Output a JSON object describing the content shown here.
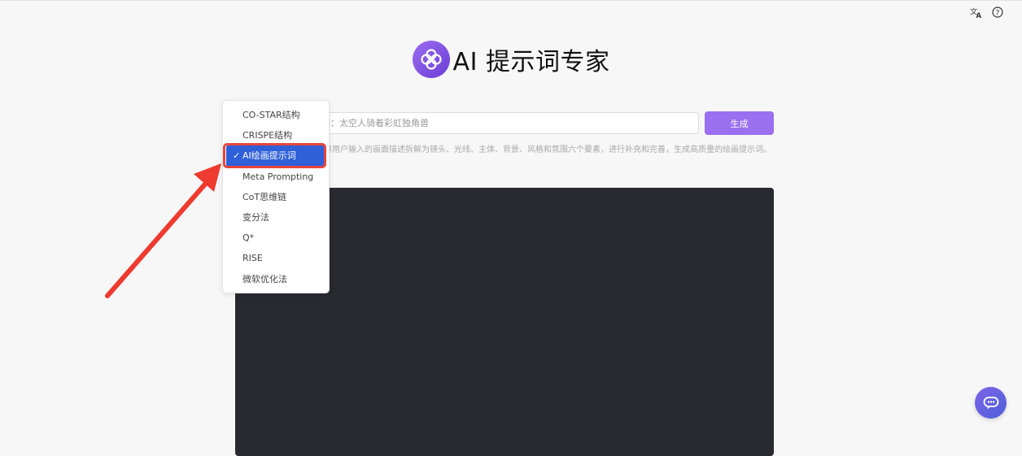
{
  "header": {
    "title": "AI 提示词专家",
    "logo_icon": "flower-logo-icon"
  },
  "top_icons": [
    "translate-icon",
    "help-icon"
  ],
  "prompt": {
    "placeholder": "如：太空人骑着彩虹独角兽",
    "value": ""
  },
  "generate_button": {
    "label": "生成"
  },
  "description": "将用户输入的画面描述拆解为镜头、光线、主体、背景、风格和氛围六个要素，进行补充和完善，生成高质量的绘画提示词。",
  "method_dropdown": {
    "selected": "AI绘画提示词",
    "options": [
      {
        "label": "CO-STAR结构"
      },
      {
        "label": "CRISPE结构"
      },
      {
        "label": "AI绘画提示词"
      },
      {
        "label": "Meta Prompting"
      },
      {
        "label": "CoT思维链"
      },
      {
        "label": "变分法"
      },
      {
        "label": "Q*"
      },
      {
        "label": "RISE"
      },
      {
        "label": "微软优化法"
      }
    ]
  },
  "output": {
    "text": ""
  },
  "colors": {
    "accent": "#9a6ff0",
    "selection": "#2f60d8",
    "annotation": "#e8453b",
    "output_bg": "#282a30"
  }
}
